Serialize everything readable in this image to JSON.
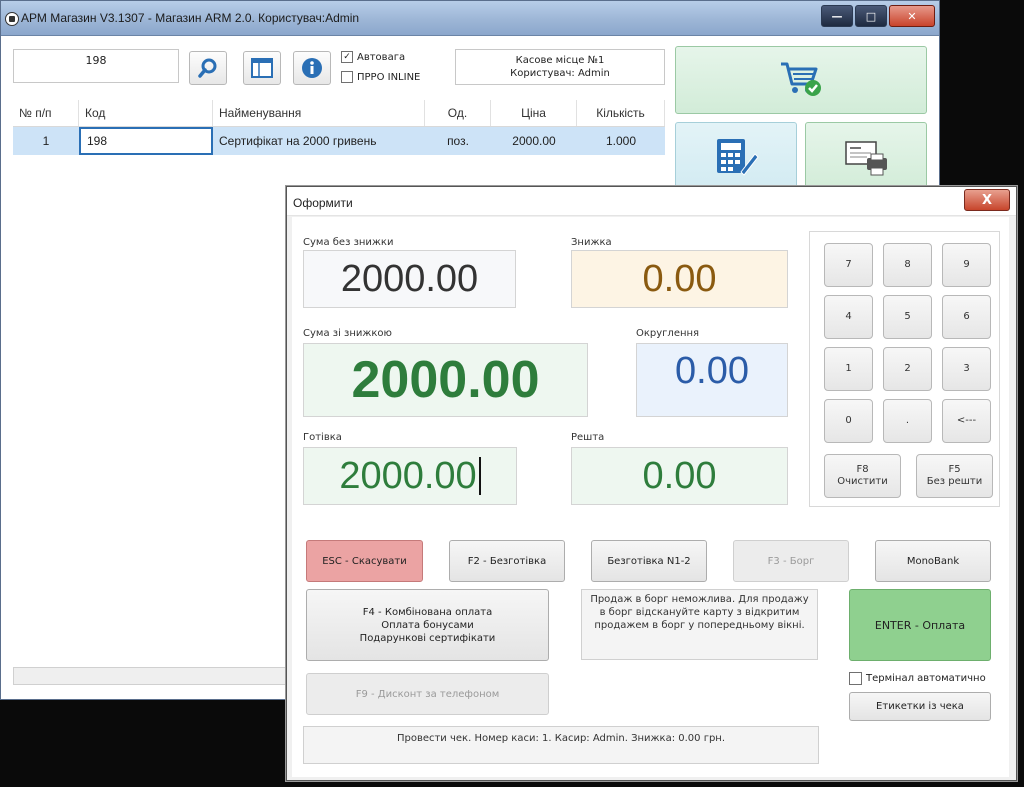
{
  "window": {
    "title": "АРМ Магазин V3.1307 - Магазин ARM 2.0. Користувач:Admin",
    "controls": {
      "minimize": "—",
      "maximize": "□",
      "close": "✕"
    }
  },
  "toolbar": {
    "code_input": "198",
    "autoweight_label": "Автовага",
    "autoweight_checked": "✓",
    "prro_label": "ПРРО INLINE",
    "cash_place": "Касове місце №1",
    "user": "Користувач: Admin"
  },
  "grid": {
    "columns": [
      "№ п/п",
      "Код",
      "Найменування",
      "Од.",
      "Ціна",
      "Кількість"
    ],
    "rows": [
      {
        "num": "1",
        "code": "198",
        "name": "Сертифікат на 2000 гривень",
        "unit": "поз.",
        "price": "2000.00",
        "qty": "1.000"
      }
    ]
  },
  "dialog": {
    "title": "Оформити",
    "close_label": "X",
    "sum_no_discount_label": "Сума без знижки",
    "sum_no_discount": "2000.00",
    "discount_label": "Знижка",
    "discount": "0.00",
    "sum_with_discount_label": "Сума зі знижкою",
    "sum_with_discount": "2000.00",
    "rounding_label": "Округлення",
    "rounding": "0.00",
    "cash_label": "Готівка",
    "cash": "2000.00",
    "change_label": "Решта",
    "change": "0.00",
    "keypad": {
      "k7": "7",
      "k8": "8",
      "k9": "9",
      "k4": "4",
      "k5": "5",
      "k6": "6",
      "k1": "1",
      "k2": "2",
      "k3": "3",
      "k0": "0",
      "kdot": ".",
      "kback": "<---",
      "f8_line1": "F8",
      "f8_line2": "Очистити",
      "f5_line1": "F5",
      "f5_line2": "Без решти"
    },
    "buttons": {
      "esc": "ESC - Скасувати",
      "f2": "F2 - Безготівка",
      "noncash_n12": "Безготівка N1-2",
      "f3": "F3 - Борг",
      "monobank": "MonoBank",
      "f4_line1": "F4 - Комбінована оплата",
      "f4_line2": "Оплата бонусами",
      "f4_line3": "Подарункові сертифікати",
      "enter": "ENTER - Оплата",
      "f9": "F9 - Дисконт за телефоном",
      "labels": "Етикетки із чека"
    },
    "debt_note": "Продаж в борг неможлива. Для продажу в борг відскануйте карту з відкритим продажем в борг у попередньому вікні.",
    "terminal_auto_label": "Термінал автоматично",
    "status": "Провести чек. Номер каси: 1. Касир: Admin. Знижка: 0.00 грн."
  },
  "colors": {
    "accent_green": "#2e7d3c",
    "discount_brown": "#8a5a10",
    "rounding_blue": "#2b5ca8",
    "selection": "#cde3f7"
  }
}
